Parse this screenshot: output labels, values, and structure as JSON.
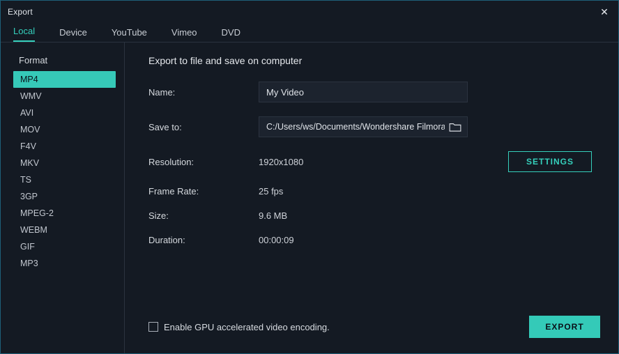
{
  "window": {
    "title": "Export"
  },
  "tabs": [
    {
      "label": "Local",
      "active": true
    },
    {
      "label": "Device",
      "active": false
    },
    {
      "label": "YouTube",
      "active": false
    },
    {
      "label": "Vimeo",
      "active": false
    },
    {
      "label": "DVD",
      "active": false
    }
  ],
  "sidebar": {
    "heading": "Format",
    "items": [
      {
        "label": "MP4",
        "active": true
      },
      {
        "label": "WMV",
        "active": false
      },
      {
        "label": "AVI",
        "active": false
      },
      {
        "label": "MOV",
        "active": false
      },
      {
        "label": "F4V",
        "active": false
      },
      {
        "label": "MKV",
        "active": false
      },
      {
        "label": "TS",
        "active": false
      },
      {
        "label": "3GP",
        "active": false
      },
      {
        "label": "MPEG-2",
        "active": false
      },
      {
        "label": "WEBM",
        "active": false
      },
      {
        "label": "GIF",
        "active": false
      },
      {
        "label": "MP3",
        "active": false
      }
    ]
  },
  "panel": {
    "headline": "Export to file and save on computer",
    "name_label": "Name:",
    "name_value": "My Video",
    "saveto_label": "Save to:",
    "saveto_value": "C:/Users/ws/Documents/Wondershare Filmora",
    "resolution_label": "Resolution:",
    "resolution_value": "1920x1080",
    "settings_label": "SETTINGS",
    "framerate_label": "Frame Rate:",
    "framerate_value": "25 fps",
    "size_label": "Size:",
    "size_value": "9.6 MB",
    "duration_label": "Duration:",
    "duration_value": "00:00:09"
  },
  "footer": {
    "gpu_label": "Enable GPU accelerated video encoding.",
    "gpu_checked": false,
    "export_label": "EXPORT"
  }
}
